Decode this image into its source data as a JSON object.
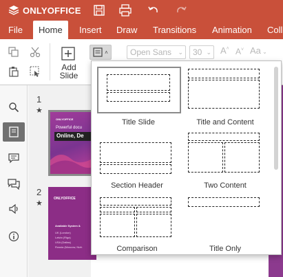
{
  "app": {
    "name": "ONLYOFFICE"
  },
  "menu": {
    "tabs": [
      "File",
      "Home",
      "Insert",
      "Draw",
      "Transitions",
      "Animation",
      "Coll"
    ],
    "active": "Home"
  },
  "toolbar": {
    "add_slide_line1": "Add",
    "add_slide_line2": "Slide",
    "font_name": "Open Sans",
    "font_size": "30",
    "increase_font": "A",
    "decrease_font": "A",
    "change_case": "Aa"
  },
  "slides": [
    {
      "number": "1",
      "title_top": "Powerful docu",
      "title_main": "Online, De",
      "brand": "ONLYOFFICE"
    },
    {
      "number": "2",
      "heading": "Available System &",
      "items": [
        "UK (London)",
        "Latvia (Riga)",
        "USA (Dallas)",
        "Russia (Moscow, Nizh"
      ],
      "brand": "ONLYOFFICE"
    }
  ],
  "layouts": [
    {
      "label": "Title Slide",
      "selected": true
    },
    {
      "label": "Title and Content",
      "selected": false
    },
    {
      "label": "Section Header",
      "selected": false
    },
    {
      "label": "Two Content",
      "selected": false
    },
    {
      "label": "Comparison",
      "selected": false
    },
    {
      "label": "Title Only",
      "selected": false
    }
  ],
  "colors": {
    "brand": "#c9503a",
    "slide_bg": "#8c3a8e"
  }
}
